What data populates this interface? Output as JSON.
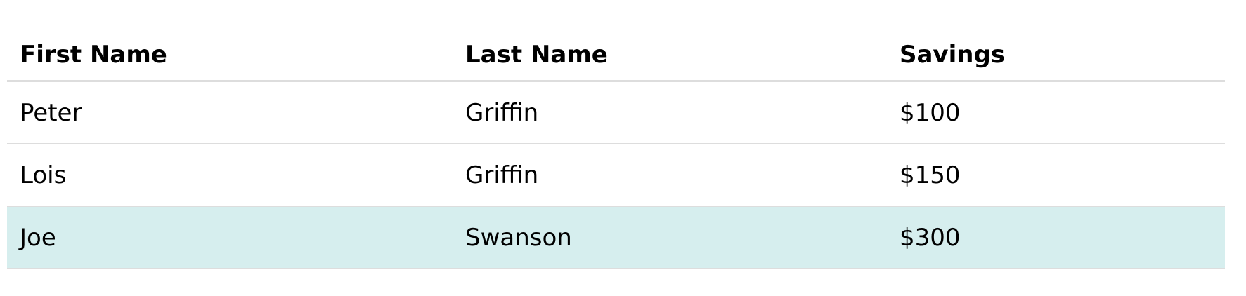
{
  "table": {
    "headers": {
      "first_name": "First Name",
      "last_name": "Last Name",
      "savings": "Savings"
    },
    "rows": [
      {
        "first_name": "Peter",
        "last_name": "Griffin",
        "savings": "$100",
        "highlighted": false
      },
      {
        "first_name": "Lois",
        "last_name": "Griffin",
        "savings": "$150",
        "highlighted": false
      },
      {
        "first_name": "Joe",
        "last_name": "Swanson",
        "savings": "$300",
        "highlighted": true
      }
    ]
  },
  "colors": {
    "background": "#ffffff",
    "row_border": "#dddddd",
    "highlight_row": "#d6eeee",
    "text": "#000000"
  }
}
